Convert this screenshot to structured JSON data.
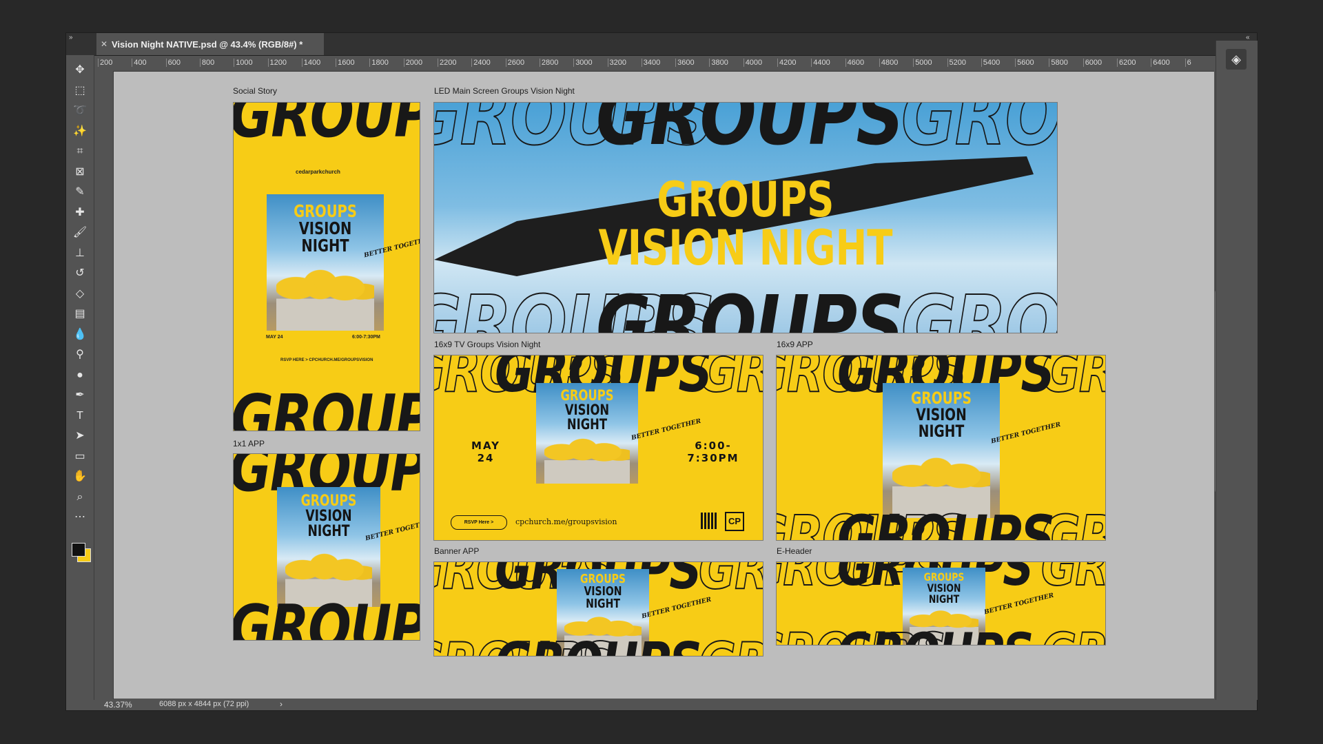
{
  "window": {
    "tab_title": "Vision Night NATIVE.psd @ 43.4% (RGB/8#) *",
    "collapse_left": "»",
    "collapse_right": "«"
  },
  "ruler": {
    "ticks": [
      "200",
      "400",
      "600",
      "800",
      "1000",
      "1200",
      "1400",
      "1600",
      "1800",
      "2000",
      "2200",
      "2400",
      "2600",
      "2800",
      "3000",
      "3200",
      "3400",
      "3600",
      "3800",
      "4000",
      "4200",
      "4400",
      "4600",
      "4800",
      "5000",
      "5200",
      "5400",
      "5600",
      "5800",
      "6000",
      "6200",
      "6400",
      "6"
    ]
  },
  "tools": [
    {
      "name": "move-tool-icon",
      "glyph": "✥"
    },
    {
      "name": "marquee-tool-icon",
      "glyph": "⬚"
    },
    {
      "name": "lasso-tool-icon",
      "glyph": "➰"
    },
    {
      "name": "magic-wand-tool-icon",
      "glyph": "✨"
    },
    {
      "name": "crop-tool-icon",
      "glyph": "⌗"
    },
    {
      "name": "frame-tool-icon",
      "glyph": "⊠"
    },
    {
      "name": "eyedropper-tool-icon",
      "glyph": "✎"
    },
    {
      "name": "healing-brush-tool-icon",
      "glyph": "✚"
    },
    {
      "name": "brush-tool-icon",
      "glyph": "🖌"
    },
    {
      "name": "stamp-tool-icon",
      "glyph": "⊥"
    },
    {
      "name": "history-brush-tool-icon",
      "glyph": "↺"
    },
    {
      "name": "eraser-tool-icon",
      "glyph": "◇"
    },
    {
      "name": "gradient-tool-icon",
      "glyph": "▤"
    },
    {
      "name": "blur-tool-icon",
      "glyph": "💧"
    },
    {
      "name": "dodge-tool-icon",
      "glyph": "⚲"
    },
    {
      "name": "smudge-tool-icon",
      "glyph": "●"
    },
    {
      "name": "pen-tool-icon",
      "glyph": "✒"
    },
    {
      "name": "type-tool-icon",
      "glyph": "T"
    },
    {
      "name": "path-selection-tool-icon",
      "glyph": "➤"
    },
    {
      "name": "rectangle-tool-icon",
      "glyph": "▭"
    },
    {
      "name": "hand-tool-icon",
      "glyph": "✋"
    },
    {
      "name": "zoom-tool-icon",
      "glyph": "⌕"
    },
    {
      "name": "more-tools-icon",
      "glyph": "⋯"
    }
  ],
  "colors": {
    "foreground": "#111111",
    "background": "#f7cc16",
    "canvas": "#bdbdbd",
    "brand_yellow": "#f7cc16"
  },
  "artboards": {
    "social_story": {
      "label": "Social Story",
      "brand": "cedarparkchurch",
      "date": "MAY 24",
      "time": "6:00-7:30PM",
      "rsvp": "RSVP HERE > CPCHURCH.ME/GROUPSVISION"
    },
    "led_main": {
      "label": "LED Main Screen Groups Vision Night",
      "title_line1": "GROUPS",
      "title_line2": "VISION NIGHT"
    },
    "tv_16x9": {
      "label": "16x9 TV Groups Vision Night",
      "date": "MAY\n24",
      "time": "6:00-\n7:30PM",
      "rsvp_button": "RSVP Here >",
      "url": "cpchurch.me/groupsvision",
      "logo": "CP"
    },
    "app_16x9": {
      "label": "16x9 APP"
    },
    "app_1x1": {
      "label": "1x1 APP"
    },
    "banner_app": {
      "label": "Banner APP"
    },
    "e_header": {
      "label": "E-Header"
    }
  },
  "poster": {
    "line1": "GROUPS",
    "line2": "VISION NIGHT",
    "tagline": "BETTER TOGETHER"
  },
  "background_word": "GROUPS",
  "status": {
    "zoom": "43.37%",
    "doc_size": "6088 px x 4844 px (72 ppi)",
    "arrow": "›"
  }
}
